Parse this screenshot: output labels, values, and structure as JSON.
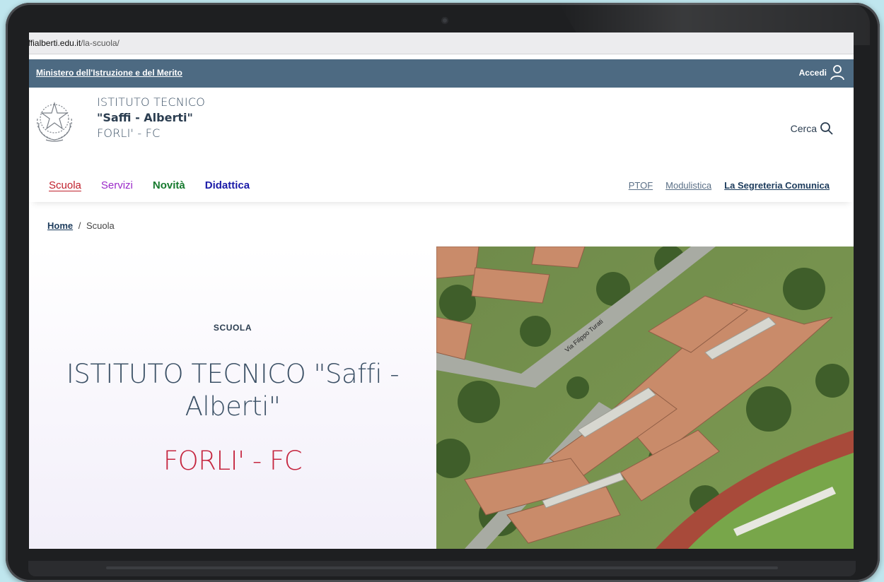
{
  "browser": {
    "url_host": "affialberti.edu.it",
    "url_path": "/la-scuola/"
  },
  "topbar": {
    "ministry_link": "Ministero dell'Istruzione e del Merito",
    "login_label": "Accedi"
  },
  "header": {
    "line1": "ISTITUTO TECNICO",
    "line2": "\"Saffi - Alberti\"",
    "line3": "FORLI' - FC",
    "search_label": "Cerca"
  },
  "nav": {
    "main": [
      "Scuola",
      "Servizi",
      "Novità",
      "Didattica"
    ],
    "secondary": [
      "PTOF",
      "Modulistica",
      "La Segreteria Comunica"
    ]
  },
  "breadcrumb": {
    "home": "Home",
    "separator": "/",
    "current": "Scuola"
  },
  "hero": {
    "eyebrow": "SCUOLA",
    "title": "ISTITUTO TECNICO \"Saffi - Alberti\"",
    "subtitle": "FORLI' - FC",
    "photo_street_label": "Via Filippo Turati"
  },
  "colors": {
    "topbar": "#4d6a82",
    "scuola": "#c0202c",
    "servizi": "#9b2ac9",
    "novita": "#167a2e",
    "didattica": "#1a1aa8",
    "hero_subtitle": "#c5263f"
  },
  "icons": {
    "login": "user-icon",
    "search": "search-icon",
    "logo": "emblem-icon"
  }
}
